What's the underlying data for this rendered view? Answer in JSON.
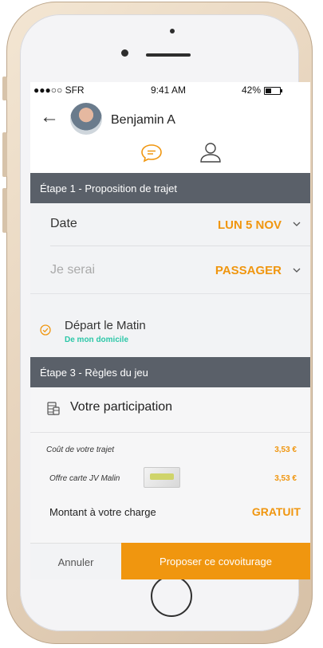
{
  "status_bar": {
    "carrier": "●●●○○ SFR",
    "time": "9:41 AM",
    "battery": "42%",
    "battery_level": 0.42
  },
  "header": {
    "back_icon": "arrow-left-icon",
    "user_name": "Benjamin A"
  },
  "tabs": [
    {
      "icon": "chat-icon",
      "active": true
    },
    {
      "icon": "person-icon",
      "active": false
    }
  ],
  "section1": {
    "title": "Étape 1 - Proposition de trajet",
    "date": {
      "label": "Date",
      "value": "LUN 5 NOV"
    },
    "role": {
      "label": "Je serai",
      "value": "PASSAGER"
    }
  },
  "departure": {
    "title": "Départ le Matin",
    "subtitle": "De mon domicile"
  },
  "section3": {
    "title": "Étape 3 - Règles du jeu",
    "participation_title": "Votre participation",
    "cost_label": "Coût de votre trajet",
    "cost_value": "3,53 €",
    "offer_label": "Offre carte JV Malin",
    "offer_value": "3,53 €",
    "amount_label": "Montant à votre charge",
    "amount_value": "GRATUIT"
  },
  "footer": {
    "cancel_label": "Annuler",
    "propose_label": "Proposer ce covoiturage"
  },
  "colors": {
    "accent": "#f0960f",
    "header_band": "#5a6069",
    "teal": "#2cc7a8"
  }
}
